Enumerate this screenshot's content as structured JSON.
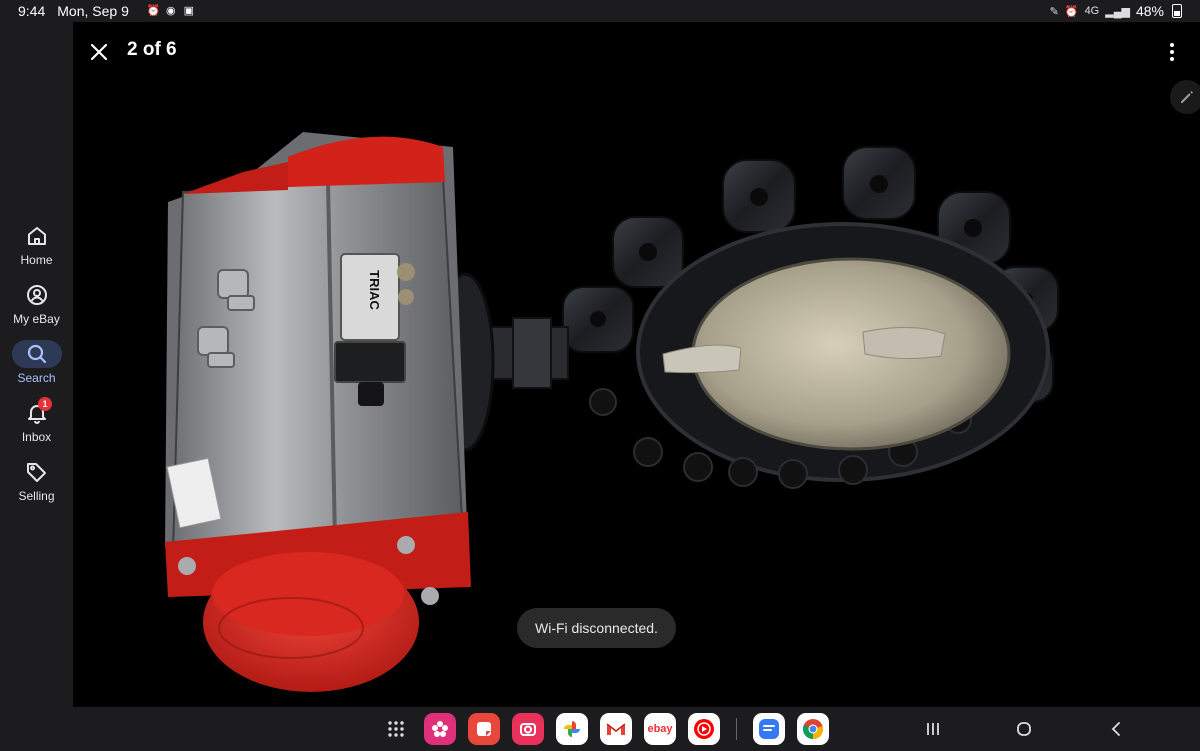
{
  "status_bar": {
    "time": "9:44",
    "date": "Mon, Sep 9",
    "network": "4G",
    "battery": "48%"
  },
  "sidebar": {
    "items": [
      {
        "label": "Home",
        "icon": "home-icon",
        "active": false
      },
      {
        "label": "My eBay",
        "icon": "account-icon",
        "active": false
      },
      {
        "label": "Search",
        "icon": "search-icon",
        "active": true
      },
      {
        "label": "Inbox",
        "icon": "bell-icon",
        "active": false,
        "badge": "1"
      },
      {
        "label": "Selling",
        "icon": "tag-icon",
        "active": false
      }
    ]
  },
  "viewer": {
    "counter": "2 of 6",
    "valve_label": "TRIAC"
  },
  "toast": {
    "message": "Wi-Fi disconnected."
  },
  "taskbar": {
    "apps": [
      {
        "name": "app-drawer",
        "color": "transparent"
      },
      {
        "name": "blossom-app",
        "color": "#e0307a"
      },
      {
        "name": "notes-app",
        "color": "#e8473a"
      },
      {
        "name": "camera-app",
        "color": "#e8325a"
      },
      {
        "name": "photos-app",
        "color": "#ffffff"
      },
      {
        "name": "gmail-app",
        "color": "#ffffff"
      },
      {
        "name": "ebay-app",
        "color": "#ffffff",
        "text": "ebay"
      },
      {
        "name": "youtube-music-app",
        "color": "#ffffff"
      },
      {
        "name": "messages-app",
        "color": "#ffffff"
      },
      {
        "name": "chrome-app",
        "color": "#ffffff"
      }
    ]
  },
  "colors": {
    "accent": "#a9c1ff",
    "badge": "#e53238",
    "background": "#1c1c1e"
  }
}
